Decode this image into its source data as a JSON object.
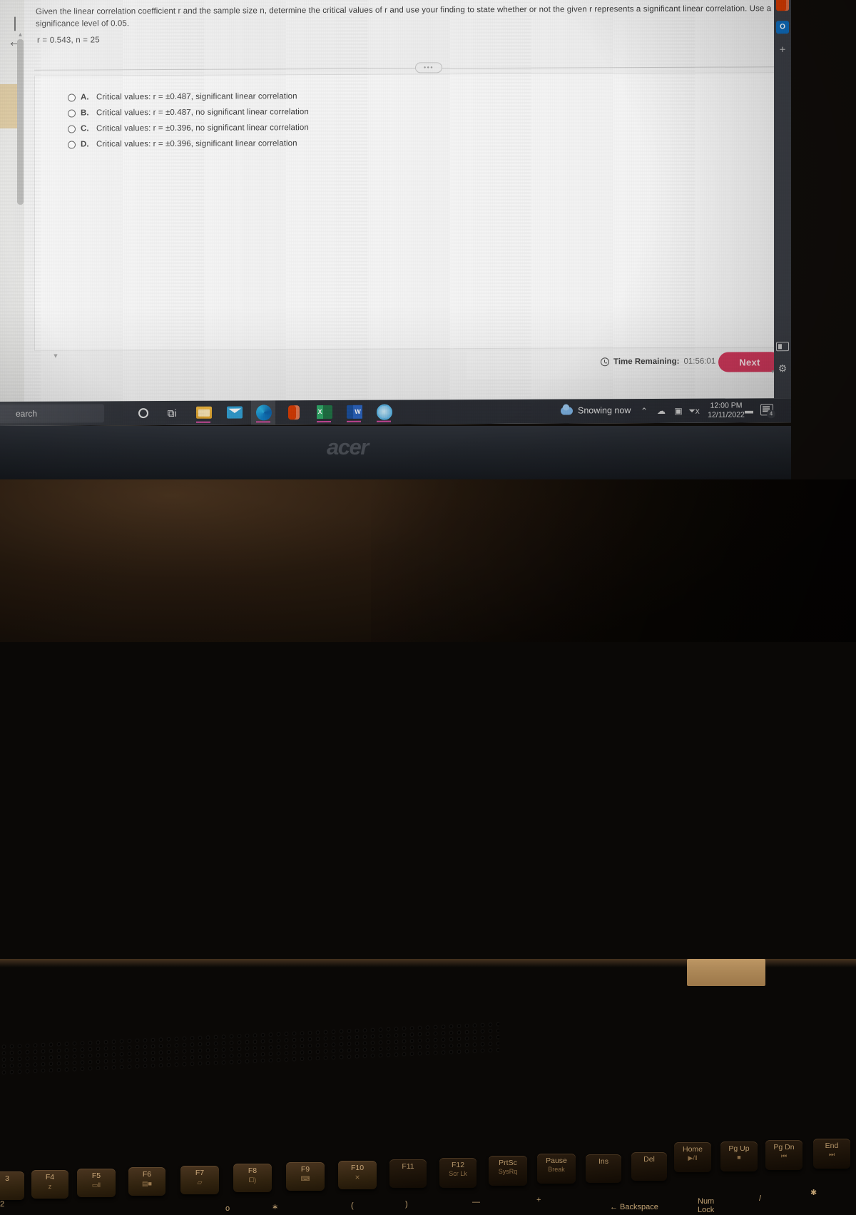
{
  "question": {
    "prompt": "Given the linear correlation coefficient r and the sample size n, determine the critical values of r and use your finding to state whether or not the given r represents a significant linear correlation. Use a significance level of 0.05.",
    "given": "r = 0.543, n = 25",
    "options": [
      {
        "letter": "A.",
        "text": "Critical values: r = ±0.487, significant linear correlation"
      },
      {
        "letter": "B.",
        "text": "Critical values: r = ±0.487, no significant linear correlation"
      },
      {
        "letter": "C.",
        "text": "Critical values: r = ±0.396, no significant linear correlation"
      },
      {
        "letter": "D.",
        "text": "Critical values: r = ±0.396, significant linear correlation"
      }
    ],
    "divider_handle": "•••",
    "scroll_up_glyph": "▲",
    "scroll_down_glyph": "▼",
    "back_to_start_glyph": "|←"
  },
  "statusbar": {
    "timer_label": "Time Remaining:",
    "timer_value": "01:56:01",
    "next_label": "Next",
    "next_color": "#d53a5e",
    "caret_glyph": "▼"
  },
  "sidebar": {
    "items": [
      {
        "name": "office-icon",
        "label": "Office"
      },
      {
        "name": "outlook-icon",
        "label": "Outlook"
      },
      {
        "name": "add-icon",
        "label": "+"
      }
    ],
    "bottom": [
      {
        "name": "panel-icon",
        "label": "Panel"
      },
      {
        "name": "settings-gear-icon",
        "label": "⚙"
      }
    ]
  },
  "taskbar": {
    "search_text": "earch",
    "apps": [
      {
        "name": "cortana-icon",
        "label": "Cortana"
      },
      {
        "name": "task-view-icon",
        "label": "⧉i"
      },
      {
        "name": "file-explorer-icon",
        "label": "File Explorer"
      },
      {
        "name": "mail-icon",
        "label": "Mail"
      },
      {
        "name": "edge-icon",
        "label": "Microsoft Edge"
      },
      {
        "name": "office-icon",
        "label": "Office"
      },
      {
        "name": "excel-icon",
        "label": "Excel"
      },
      {
        "name": "word-icon",
        "label": "Word"
      },
      {
        "name": "app-icon",
        "label": "App"
      }
    ],
    "tray": {
      "weather": "Snowing now",
      "chevron": "⌃",
      "onedrive": "☁",
      "network": "▣",
      "volume": "⏷x",
      "battery": "▬",
      "time": "12:00 PM",
      "date": "12/11/2022",
      "notification_count": "4"
    }
  },
  "laptop": {
    "brand": "acer",
    "keys_row1": [
      {
        "label": "3",
        "sub": "",
        "glyph": ""
      },
      {
        "label": "F4",
        "sub": "",
        "glyph": "z"
      },
      {
        "label": "F5",
        "sub": "",
        "glyph": "▭‖"
      },
      {
        "label": "F6",
        "sub": "",
        "glyph": "▤■"
      },
      {
        "label": "F7",
        "sub": "",
        "glyph": "▱"
      },
      {
        "label": "F8",
        "sub": "",
        "glyph": "⧠)"
      },
      {
        "label": "F9",
        "sub": "",
        "glyph": "⌨"
      },
      {
        "label": "F10",
        "sub": "",
        "glyph": "⨯"
      },
      {
        "label": "F11",
        "sub": "",
        "glyph": ""
      },
      {
        "label": "F12",
        "sub": "Scr Lk",
        "glyph": ""
      },
      {
        "label": "PrtSc",
        "sub": "SysRq",
        "glyph": ""
      },
      {
        "label": "Pause",
        "sub": "Break",
        "glyph": ""
      },
      {
        "label": "Ins",
        "sub": "",
        "glyph": ""
      },
      {
        "label": "Del",
        "sub": "",
        "glyph": ""
      },
      {
        "label": "Home",
        "sub": "▶/‖",
        "glyph": ""
      },
      {
        "label": "Pg Up",
        "sub": "■",
        "glyph": ""
      },
      {
        "label": "Pg Dn",
        "sub": "⏮",
        "glyph": ""
      },
      {
        "label": "End",
        "sub": "⏭",
        "glyph": ""
      }
    ],
    "keys_row2": [
      {
        "label": "2"
      },
      {
        "label": "—"
      },
      {
        "label": "("
      },
      {
        "label": ")"
      },
      {
        "label": "—"
      },
      {
        "label": "+"
      },
      {
        "label": "← Backspace"
      },
      {
        "label": "Num"
      },
      {
        "label": "Lock"
      },
      {
        "label": "/"
      },
      {
        "label": "✱"
      },
      {
        "label": "∗"
      },
      {
        "label": "o"
      }
    ]
  }
}
